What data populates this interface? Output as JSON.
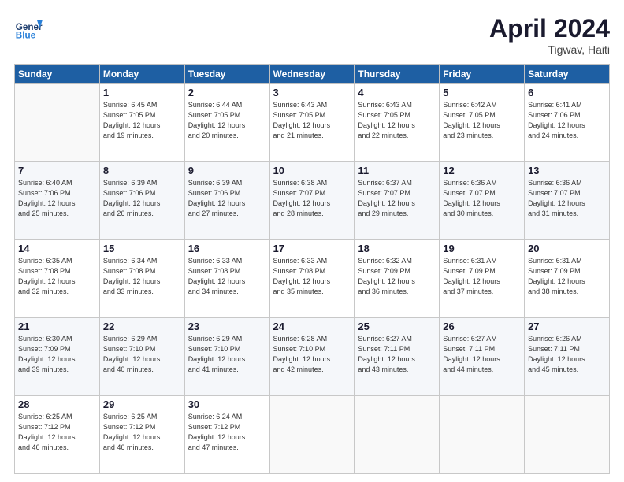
{
  "header": {
    "title": "April 2024",
    "location": "Tigwav, Haiti"
  },
  "columns": [
    "Sunday",
    "Monday",
    "Tuesday",
    "Wednesday",
    "Thursday",
    "Friday",
    "Saturday"
  ],
  "weeks": [
    [
      {
        "day": "",
        "info": ""
      },
      {
        "day": "1",
        "info": "Sunrise: 6:45 AM\nSunset: 7:05 PM\nDaylight: 12 hours\nand 19 minutes."
      },
      {
        "day": "2",
        "info": "Sunrise: 6:44 AM\nSunset: 7:05 PM\nDaylight: 12 hours\nand 20 minutes."
      },
      {
        "day": "3",
        "info": "Sunrise: 6:43 AM\nSunset: 7:05 PM\nDaylight: 12 hours\nand 21 minutes."
      },
      {
        "day": "4",
        "info": "Sunrise: 6:43 AM\nSunset: 7:05 PM\nDaylight: 12 hours\nand 22 minutes."
      },
      {
        "day": "5",
        "info": "Sunrise: 6:42 AM\nSunset: 7:05 PM\nDaylight: 12 hours\nand 23 minutes."
      },
      {
        "day": "6",
        "info": "Sunrise: 6:41 AM\nSunset: 7:06 PM\nDaylight: 12 hours\nand 24 minutes."
      }
    ],
    [
      {
        "day": "7",
        "info": "Sunrise: 6:40 AM\nSunset: 7:06 PM\nDaylight: 12 hours\nand 25 minutes."
      },
      {
        "day": "8",
        "info": "Sunrise: 6:39 AM\nSunset: 7:06 PM\nDaylight: 12 hours\nand 26 minutes."
      },
      {
        "day": "9",
        "info": "Sunrise: 6:39 AM\nSunset: 7:06 PM\nDaylight: 12 hours\nand 27 minutes."
      },
      {
        "day": "10",
        "info": "Sunrise: 6:38 AM\nSunset: 7:07 PM\nDaylight: 12 hours\nand 28 minutes."
      },
      {
        "day": "11",
        "info": "Sunrise: 6:37 AM\nSunset: 7:07 PM\nDaylight: 12 hours\nand 29 minutes."
      },
      {
        "day": "12",
        "info": "Sunrise: 6:36 AM\nSunset: 7:07 PM\nDaylight: 12 hours\nand 30 minutes."
      },
      {
        "day": "13",
        "info": "Sunrise: 6:36 AM\nSunset: 7:07 PM\nDaylight: 12 hours\nand 31 minutes."
      }
    ],
    [
      {
        "day": "14",
        "info": "Sunrise: 6:35 AM\nSunset: 7:08 PM\nDaylight: 12 hours\nand 32 minutes."
      },
      {
        "day": "15",
        "info": "Sunrise: 6:34 AM\nSunset: 7:08 PM\nDaylight: 12 hours\nand 33 minutes."
      },
      {
        "day": "16",
        "info": "Sunrise: 6:33 AM\nSunset: 7:08 PM\nDaylight: 12 hours\nand 34 minutes."
      },
      {
        "day": "17",
        "info": "Sunrise: 6:33 AM\nSunset: 7:08 PM\nDaylight: 12 hours\nand 35 minutes."
      },
      {
        "day": "18",
        "info": "Sunrise: 6:32 AM\nSunset: 7:09 PM\nDaylight: 12 hours\nand 36 minutes."
      },
      {
        "day": "19",
        "info": "Sunrise: 6:31 AM\nSunset: 7:09 PM\nDaylight: 12 hours\nand 37 minutes."
      },
      {
        "day": "20",
        "info": "Sunrise: 6:31 AM\nSunset: 7:09 PM\nDaylight: 12 hours\nand 38 minutes."
      }
    ],
    [
      {
        "day": "21",
        "info": "Sunrise: 6:30 AM\nSunset: 7:09 PM\nDaylight: 12 hours\nand 39 minutes."
      },
      {
        "day": "22",
        "info": "Sunrise: 6:29 AM\nSunset: 7:10 PM\nDaylight: 12 hours\nand 40 minutes."
      },
      {
        "day": "23",
        "info": "Sunrise: 6:29 AM\nSunset: 7:10 PM\nDaylight: 12 hours\nand 41 minutes."
      },
      {
        "day": "24",
        "info": "Sunrise: 6:28 AM\nSunset: 7:10 PM\nDaylight: 12 hours\nand 42 minutes."
      },
      {
        "day": "25",
        "info": "Sunrise: 6:27 AM\nSunset: 7:11 PM\nDaylight: 12 hours\nand 43 minutes."
      },
      {
        "day": "26",
        "info": "Sunrise: 6:27 AM\nSunset: 7:11 PM\nDaylight: 12 hours\nand 44 minutes."
      },
      {
        "day": "27",
        "info": "Sunrise: 6:26 AM\nSunset: 7:11 PM\nDaylight: 12 hours\nand 45 minutes."
      }
    ],
    [
      {
        "day": "28",
        "info": "Sunrise: 6:25 AM\nSunset: 7:12 PM\nDaylight: 12 hours\nand 46 minutes."
      },
      {
        "day": "29",
        "info": "Sunrise: 6:25 AM\nSunset: 7:12 PM\nDaylight: 12 hours\nand 46 minutes."
      },
      {
        "day": "30",
        "info": "Sunrise: 6:24 AM\nSunset: 7:12 PM\nDaylight: 12 hours\nand 47 minutes."
      },
      {
        "day": "",
        "info": ""
      },
      {
        "day": "",
        "info": ""
      },
      {
        "day": "",
        "info": ""
      },
      {
        "day": "",
        "info": ""
      }
    ]
  ]
}
